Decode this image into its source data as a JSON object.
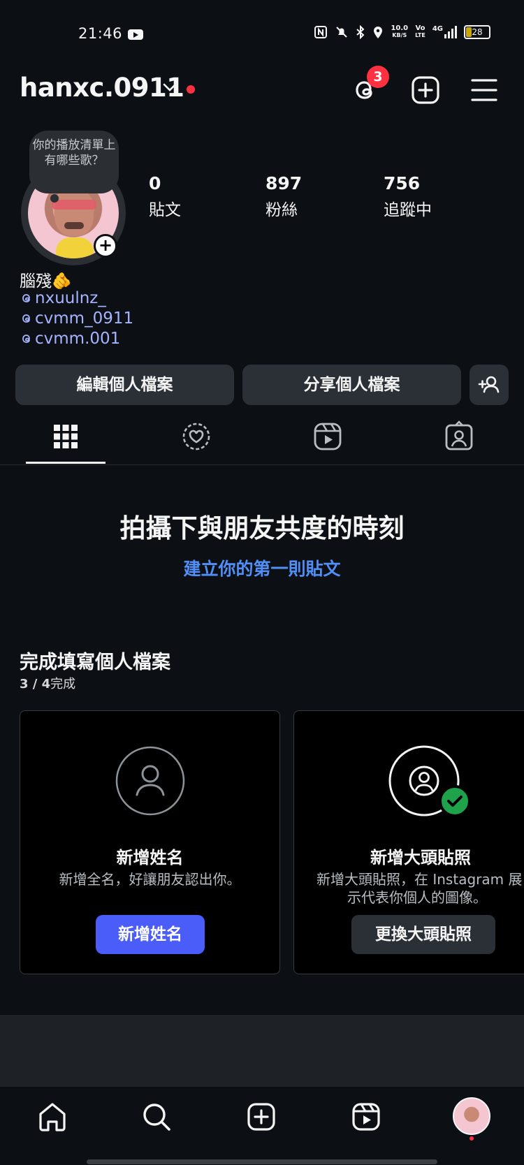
{
  "status_bar": {
    "time": "21:46",
    "net_speed": "10.0",
    "net_unit": "KB/S",
    "volte_top": "Vo",
    "volte_bottom": "LTE",
    "network": "4G",
    "battery": "28",
    "battery_level": 0.28
  },
  "header": {
    "username": "hanxc.0911",
    "threads_badge": "3"
  },
  "profile": {
    "note": "你的播放清單上有哪些歌？",
    "stats": [
      {
        "value": "0",
        "label": "貼文"
      },
      {
        "value": "897",
        "label": "粉絲"
      },
      {
        "value": "756",
        "label": "追蹤中"
      }
    ],
    "bio_name": "腦殘🫵",
    "links": [
      "nxuulnz_",
      "cvmm_0911",
      "cvmm.001"
    ]
  },
  "actions": {
    "edit": "編輯個人檔案",
    "share": "分享個人檔案"
  },
  "empty_state": {
    "title": "拍攝下與朋友共度的時刻",
    "link": "建立你的第一則貼文"
  },
  "complete_profile": {
    "title": "完成填寫個人檔案",
    "progress_done": "3",
    "progress_total": "4",
    "progress_suffix": "完成",
    "cards": [
      {
        "title": "新增姓名",
        "desc": "新增全名，好讓朋友認出你。",
        "button": "新增姓名"
      },
      {
        "title": "新增大頭貼照",
        "desc_line1": "新增大頭貼照，在 Instagram 展",
        "desc_line2": "示代表你個人的圖像。",
        "button": "更換大頭貼照"
      }
    ]
  },
  "colors": {
    "background": "#0c1014",
    "accent_blue": "#4f8ff7",
    "button_primary": "#4a5df9",
    "link": "#a6b3ff",
    "badge_red": "#ff3040",
    "check_green": "#1ea24a"
  }
}
